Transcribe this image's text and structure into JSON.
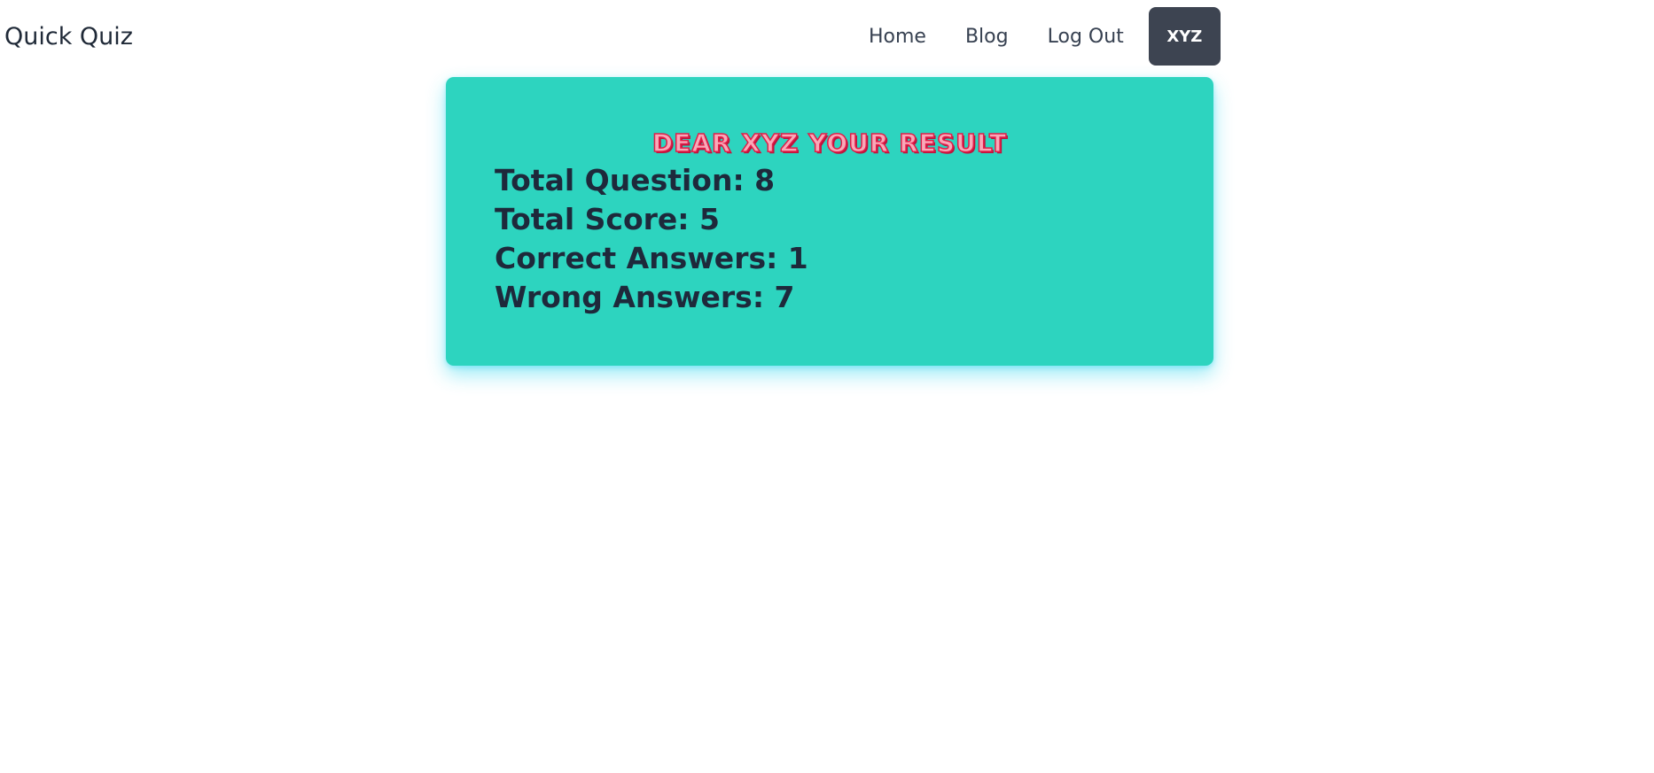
{
  "brand": "Quick Quiz",
  "nav": {
    "home": "Home",
    "blog": "Blog",
    "logout": "Log Out",
    "user": "XYZ"
  },
  "result": {
    "title": "DEAR XYZ YOUR RESULT",
    "total_question": "Total Question: 8",
    "total_score": "Total Score: 5",
    "correct_answers": "Correct Answers: 1",
    "wrong_answers": "Wrong Answers: 7"
  },
  "colors": {
    "card": "#2dd4bf",
    "avatar": "#3d4451",
    "title_stroke": "#e11d48"
  }
}
